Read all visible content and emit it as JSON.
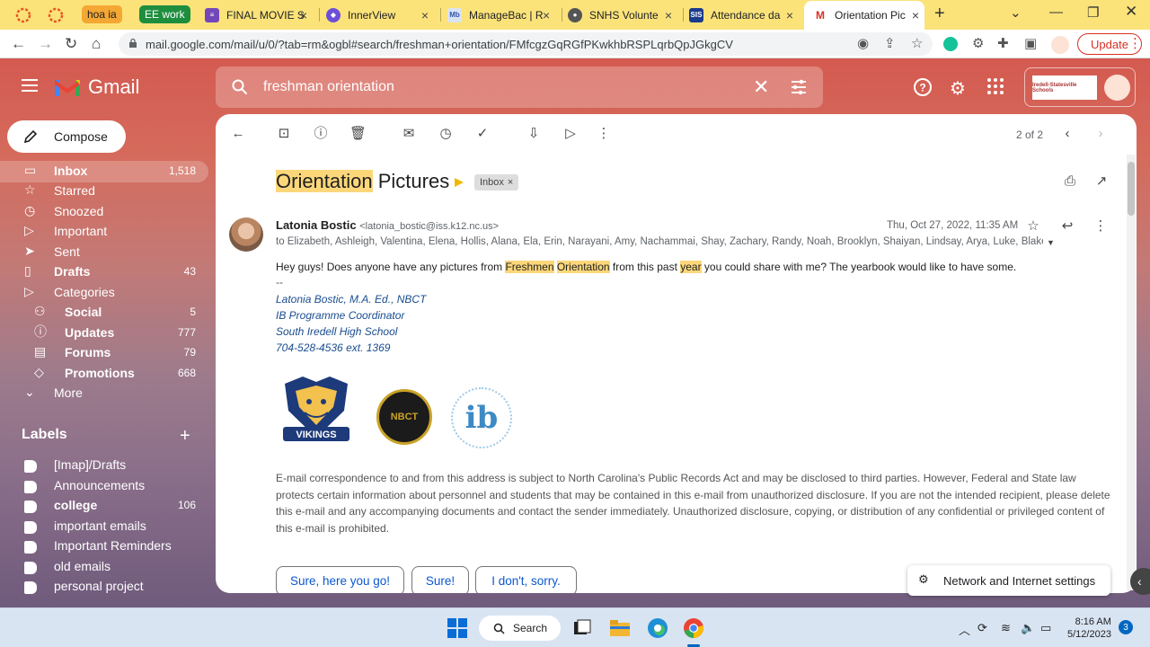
{
  "browser": {
    "tabs": [
      {
        "label": "",
        "favicon": "ring-icon"
      },
      {
        "label": "",
        "favicon": "ring-icon"
      },
      {
        "label": "hoa ia",
        "group": true
      },
      {
        "label": "EE work",
        "group": true
      },
      {
        "label": "FINAL MOVIE S"
      },
      {
        "label": "InnerView"
      },
      {
        "label": "ManageBac | R"
      },
      {
        "label": "SNHS Volunte"
      },
      {
        "label": "Attendance da"
      },
      {
        "label": "Orientation Pic",
        "active": true
      }
    ],
    "url": "mail.google.com/mail/u/0/?tab=rm&ogbl#search/freshman+orientation/FMfcgzGqRGfPKwkhbRSPLqrbQpJGkgCV",
    "update_label": "Update"
  },
  "gmail": {
    "app_name": "Gmail",
    "search_value": "freshman orientation",
    "account_logo_text": "Iredell-Statesville Schools",
    "compose_label": "Compose",
    "nav": [
      {
        "label": "Inbox",
        "count": "1,518",
        "bold": true
      },
      {
        "label": "Starred",
        "count": ""
      },
      {
        "label": "Snoozed",
        "count": ""
      },
      {
        "label": "Important",
        "count": ""
      },
      {
        "label": "Sent",
        "count": ""
      },
      {
        "label": "Drafts",
        "count": "43",
        "bold": true
      },
      {
        "label": "Categories",
        "count": ""
      },
      {
        "label": "Social",
        "count": "5",
        "bold": true,
        "sub": true
      },
      {
        "label": "Updates",
        "count": "777",
        "bold": true,
        "sub": true
      },
      {
        "label": "Forums",
        "count": "79",
        "bold": true,
        "sub": true
      },
      {
        "label": "Promotions",
        "count": "668",
        "bold": true,
        "sub": true
      },
      {
        "label": "More",
        "count": ""
      }
    ],
    "labels_header": "Labels",
    "labels": [
      {
        "label": "[Imap]/Drafts",
        "count": ""
      },
      {
        "label": "Announcements",
        "count": ""
      },
      {
        "label": "college",
        "count": "106",
        "bold": true
      },
      {
        "label": "important emails",
        "count": ""
      },
      {
        "label": "Important Reminders",
        "count": ""
      },
      {
        "label": "old emails",
        "count": ""
      },
      {
        "label": "personal project",
        "count": ""
      }
    ]
  },
  "email": {
    "pager": "2 of 2",
    "subject_highlight": "Orientation",
    "subject_rest": " Pictures",
    "inbox_chip": "Inbox",
    "sender_name": "Latonia Bostic",
    "sender_email": "<latonia_bostic@iss.k12.nc.us>",
    "date": "Thu, Oct 27, 2022, 11:35 AM",
    "recipients": "to Elizabeth, Ashleigh, Valentina, Elena, Hollis, Alana, Ela, Erin, Narayani, Amy, Nachammai, Shay, Zachary, Randy, Noah, Brooklyn, Shaiyan, Lindsay, Arya, Luke, Blake, M",
    "body_parts": [
      {
        "text": "Hey guys! Does anyone have any pictures from ",
        "hl": false
      },
      {
        "text": "Freshmen",
        "hl": true
      },
      {
        "text": " ",
        "hl": false
      },
      {
        "text": "Orientation",
        "hl": true
      },
      {
        "text": " from this past ",
        "hl": false
      },
      {
        "text": "year",
        "hl": true
      },
      {
        "text": " you could share with me? The yearbook would like to have some.",
        "hl": false
      }
    ],
    "sig_dash": "--",
    "signature": [
      "Latonia Bostic, M.A. Ed., NBCT",
      "IB Programme Coordinator",
      "South Iredell High School",
      "704-528-4536 ext. 1369"
    ],
    "logos": {
      "vikings": "VIKINGS",
      "nbct": "NBCT",
      "ib": "ib"
    },
    "disclaimer": "E-mail correspondence to and from this address is subject to North Carolina's Public Records Act and may be disclosed to third parties. However, Federal and State law protects certain information about personnel and students that may be contained in this e-mail from unauthorized disclosure. If you are not the intended recipient, please delete this e-mail and any accompanying documents and contact the sender immediately. Unauthorized disclosure, copying, or distribution of any confidential or privileged content of this e-mail is prohibited.",
    "smart_replies": [
      "Sure, here you go!",
      "Sure!",
      "I don't, sorry."
    ]
  },
  "toast": {
    "label": "Network and Internet settings"
  },
  "taskbar": {
    "search_label": "Search",
    "time": "8:16 AM",
    "date": "5/12/2023",
    "notifications": "3"
  }
}
